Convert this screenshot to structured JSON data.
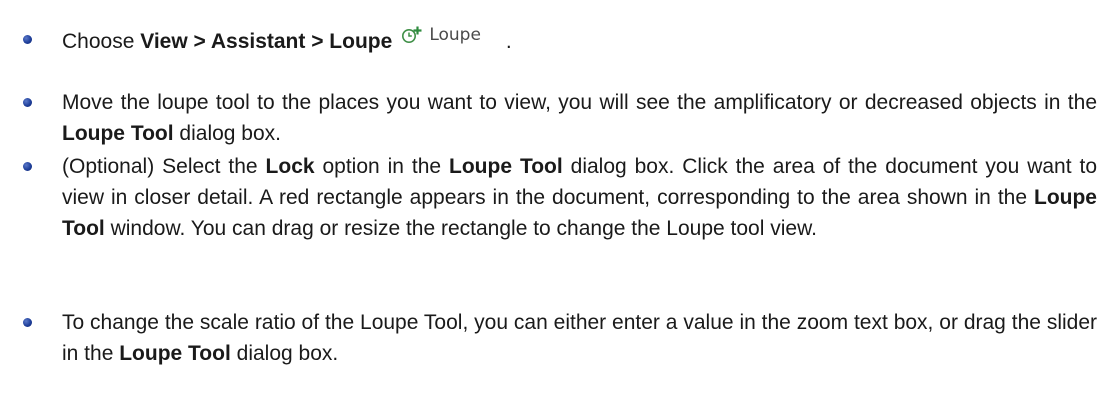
{
  "steps": [
    {
      "segments": [
        {
          "t": "Choose ",
          "b": false
        },
        {
          "t": "View > Assistant > Loupe",
          "b": true
        }
      ],
      "button": {
        "icon": "loupe-plus-icon",
        "label": "Loupe"
      },
      "trailing": "."
    },
    {
      "segments": [
        {
          "t": "Move the loupe tool to the places you want to view, you will see the amplificatory or decreased objects in the ",
          "b": false
        },
        {
          "t": "Loupe Tool",
          "b": true
        },
        {
          "t": " dialog box.",
          "b": false
        }
      ]
    },
    {
      "segments": [
        {
          "t": "(Optional) Select the ",
          "b": false
        },
        {
          "t": "Lock",
          "b": true
        },
        {
          "t": " option in the ",
          "b": false
        },
        {
          "t": "Loupe Tool",
          "b": true
        },
        {
          "t": " dialog box. Click the area of the document you want to view in closer detail. A red rectangle appears in the document, corresponding to the area shown in the ",
          "b": false
        },
        {
          "t": "Loupe Tool",
          "b": true
        },
        {
          "t": " window. You can drag or resize the rectangle to change the Loupe tool view.",
          "b": false
        }
      ]
    },
    {
      "segments": [
        {
          "t": "To change the scale ratio of the Loupe Tool, you can either enter a value in the zoom text box, or drag the slider in the ",
          "b": false
        },
        {
          "t": "Loupe Tool",
          "b": true
        },
        {
          "t": " dialog box.",
          "b": false
        }
      ]
    }
  ],
  "colors": {
    "bullet": "#1f3f9a",
    "text": "#1a1a1a",
    "icon_green": "#2e8b3e"
  }
}
